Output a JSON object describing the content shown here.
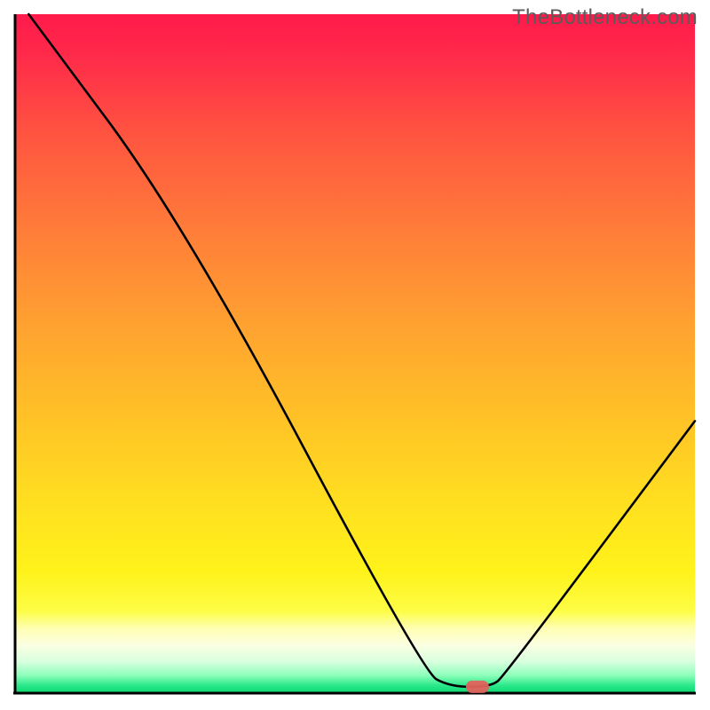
{
  "watermark": "TheBottleneck.com",
  "chart_data": {
    "type": "line",
    "title": "",
    "xlabel": "",
    "ylabel": "",
    "xlim": [
      0,
      100
    ],
    "ylim": [
      0,
      100
    ],
    "grid": false,
    "legend": false,
    "note": "Values estimated from pixel positions; no axis ticks present",
    "curve": {
      "name": "bottleneck-curve",
      "points": [
        {
          "x": 2.0,
          "y": 100.0
        },
        {
          "x": 25.0,
          "y": 69.0
        },
        {
          "x": 60.0,
          "y": 3.0
        },
        {
          "x": 64.0,
          "y": 0.8
        },
        {
          "x": 70.0,
          "y": 0.8
        },
        {
          "x": 72.0,
          "y": 2.5
        },
        {
          "x": 100.0,
          "y": 40.0
        }
      ]
    },
    "marker": {
      "name": "optimal-point",
      "x": 68.0,
      "y": 0.8,
      "color_hex": "#e2615d"
    },
    "gradient_stops": [
      {
        "pos": 0.0,
        "color": "#ff1a4b"
      },
      {
        "pos": 0.06,
        "color": "#ff2a4a"
      },
      {
        "pos": 0.18,
        "color": "#ff5540"
      },
      {
        "pos": 0.32,
        "color": "#ff7d39"
      },
      {
        "pos": 0.46,
        "color": "#ffa230"
      },
      {
        "pos": 0.6,
        "color": "#ffc326"
      },
      {
        "pos": 0.72,
        "color": "#ffdf20"
      },
      {
        "pos": 0.82,
        "color": "#fff21a"
      },
      {
        "pos": 0.88,
        "color": "#fdfd45"
      },
      {
        "pos": 0.905,
        "color": "#ffffb0"
      },
      {
        "pos": 0.93,
        "color": "#fcffe2"
      },
      {
        "pos": 0.955,
        "color": "#d8ffde"
      },
      {
        "pos": 0.975,
        "color": "#8dffba"
      },
      {
        "pos": 0.99,
        "color": "#2ae88a"
      },
      {
        "pos": 1.0,
        "color": "#0fd873"
      }
    ],
    "axis_color_hex": "#000000",
    "curve_color_hex": "#000000"
  }
}
